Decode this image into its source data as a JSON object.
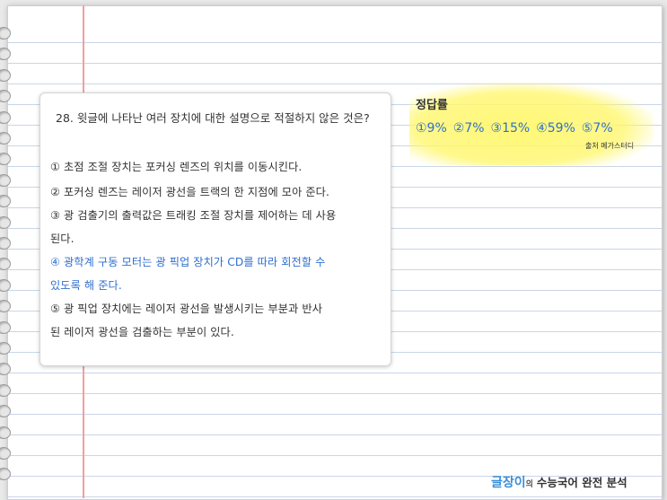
{
  "question": {
    "title": "28. 윗글에 나타난 여러 장치에 대한 설명으로 적절하지 않은 것은?",
    "options": [
      {
        "lines": [
          "① 초점 조절 장치는 포커싱 렌즈의 위치를 이동시킨다."
        ],
        "highlight": false
      },
      {
        "lines": [
          "② 포커싱 렌즈는 레이저 광선을 트랙의 한 지점에 모아 준다."
        ],
        "highlight": false
      },
      {
        "lines": [
          "③ 광 검출기의 출력값은 트래킹 조절 장치를 제어하는 데 사용",
          "된다."
        ],
        "highlight": false
      },
      {
        "lines": [
          "④ 광학계 구동 모터는 광 픽업 장치가 CD를 따라 회전할 수",
          "있도록 해 준다."
        ],
        "highlight": true
      },
      {
        "lines": [
          "⑤ 광 픽업 장치에는 레이저 광선을 발생시키는 부분과 반사",
          "된 레이저 광선을 검출하는 부분이 있다."
        ],
        "highlight": false
      }
    ]
  },
  "answer_rate": {
    "title": "정답률",
    "values": [
      "①9%",
      "②7%",
      "③15%",
      "④59%",
      "⑤7%"
    ],
    "source": "출처 메가스터디"
  },
  "brand": {
    "part1": "글장이",
    "part2": "의",
    "part3": "수능국어 완전 분석"
  },
  "colors": {
    "answer_blue": "#2f6fcf",
    "highlight_yellow": "#fff76e",
    "margin_red": "#f0a0a0",
    "rule_blue": "#c9d6e8"
  }
}
